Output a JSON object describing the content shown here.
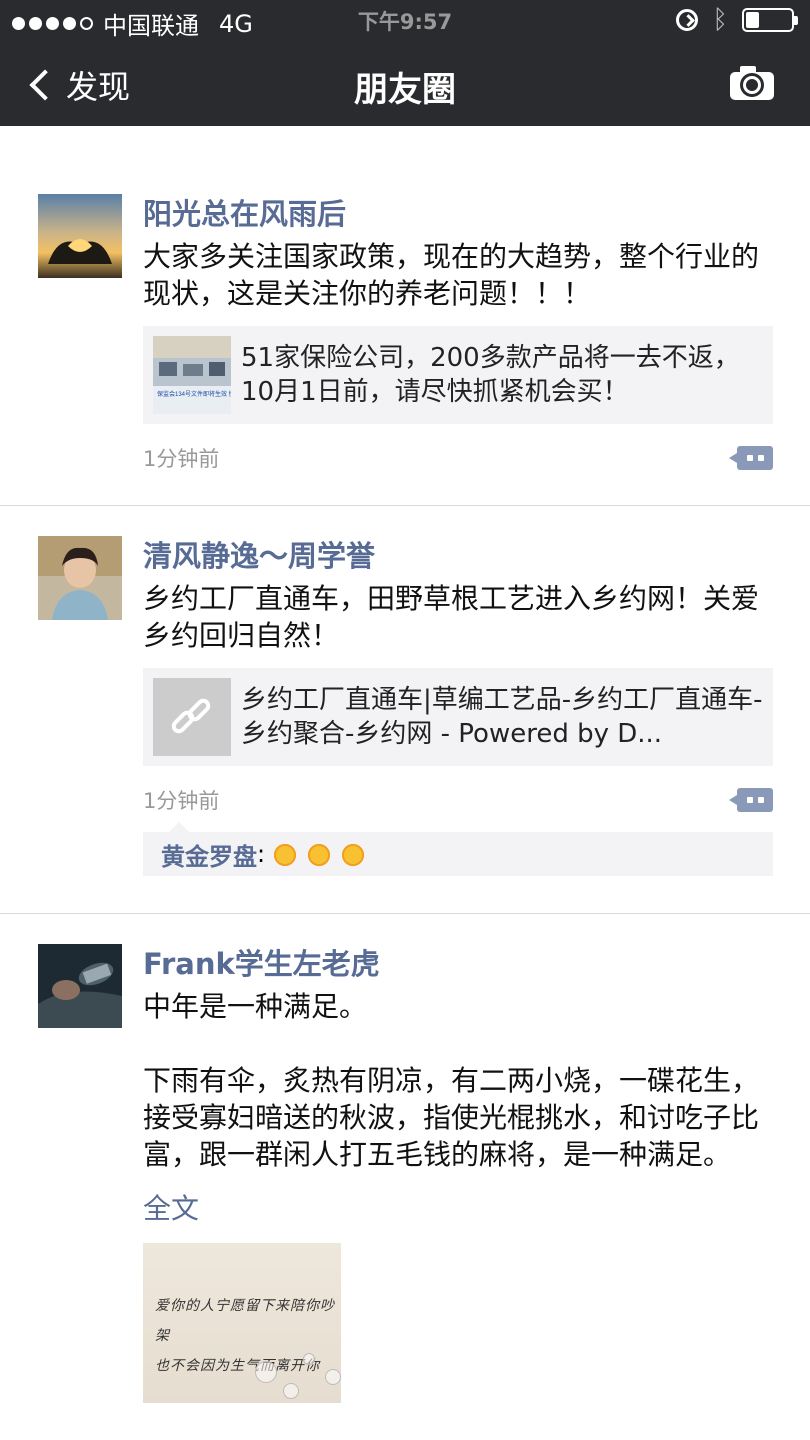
{
  "status_bar": {
    "carrier": "中国联通",
    "network": "4G",
    "time": "下午9:57",
    "battery_level": 0.3,
    "signal_bars_filled": 4,
    "signal_bars_total": 5
  },
  "nav": {
    "back_label": "发现",
    "title": "朋友圈"
  },
  "posts": [
    {
      "author": "阳光总在风雨后",
      "text": "大家多关注国家政策，现在的大趋势，整个行业的现状，这是关注你的养老问题！！！",
      "card": {
        "text": "51家保险公司，200多款产品将一去不返，10月1日前，请尽快抓紧机会买！",
        "thumb_caption": "保监会134号文件即将生效 快速通道产品就会被停售"
      },
      "time": "1分钟前"
    },
    {
      "author": "清风静逸～周学誉",
      "text": "乡约工厂直通车，田野草根工艺进入乡约网！关爱乡约回归自然！",
      "card": {
        "text": "乡约工厂直通车|草编工艺品-乡约工厂直通车-乡约聚合-乡约网 - Powered by D..."
      },
      "time": "1分钟前",
      "likes": {
        "who": "黄金罗盘",
        "sep": ":",
        "emoji_count": 3,
        "emoji_icon": "sun-emoji-icon"
      }
    },
    {
      "author": "Frank学生左老虎",
      "text": "中年是一种满足。\n\n下雨有伞，炙热有阴凉，有二两小烧，一碟花生，接受寡妇暗送的秋波，指使光棍挑水，和讨吃子比富，跟一群闲人打五毛钱的麻将，是一种满足。",
      "full_text_link": "全文",
      "photo_text": [
        "爱你的人宁愿留下来陪你吵架",
        "也不会因为生气而离开你"
      ]
    }
  ],
  "colors": {
    "nav_bg": "#2a2b2e",
    "name_link": "#576b95",
    "card_bg": "#f3f3f5",
    "time_gray": "#999999"
  }
}
